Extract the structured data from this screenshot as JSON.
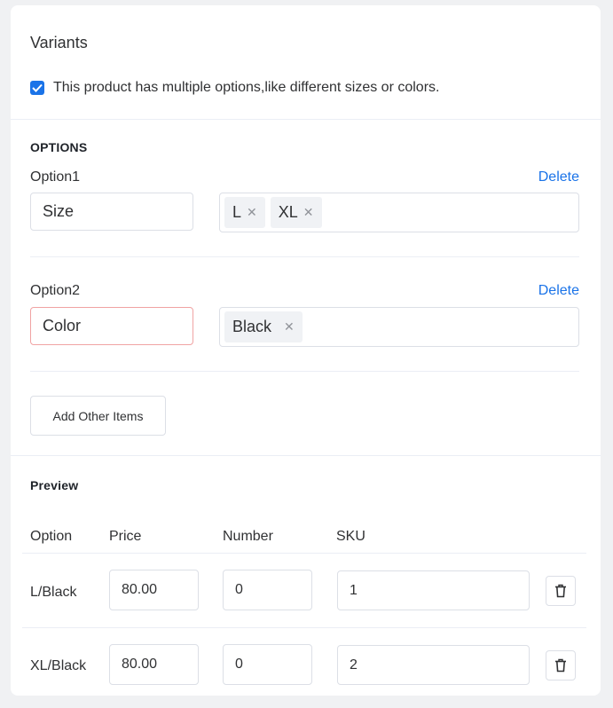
{
  "variants": {
    "title": "Variants",
    "multiple_options_checked": true,
    "multiple_options_label": "This product has multiple options,like different sizes or colors."
  },
  "options": {
    "heading": "OPTIONS",
    "delete_label": "Delete",
    "items": [
      {
        "label": "Option1",
        "name": "Size",
        "values": [
          "L",
          "XL"
        ]
      },
      {
        "label": "Option2",
        "name": "Color",
        "values": [
          "Black"
        ]
      }
    ],
    "add_button_label": "Add Other Items"
  },
  "preview": {
    "heading": "Preview",
    "columns": [
      "Option",
      "Price",
      "Number",
      "SKU"
    ],
    "rows": [
      {
        "option": "L/Black",
        "price": "80.00",
        "number": "0",
        "sku": "1"
      },
      {
        "option": "XL/Black",
        "price": "80.00",
        "number": "0",
        "sku": "2"
      }
    ]
  },
  "icons": {
    "remove_tag": "close-icon",
    "delete_row": "trash-icon",
    "checkbox": "checkmark-icon"
  },
  "colors": {
    "accent": "#1a73e8",
    "error_border": "#f0a3a3"
  }
}
